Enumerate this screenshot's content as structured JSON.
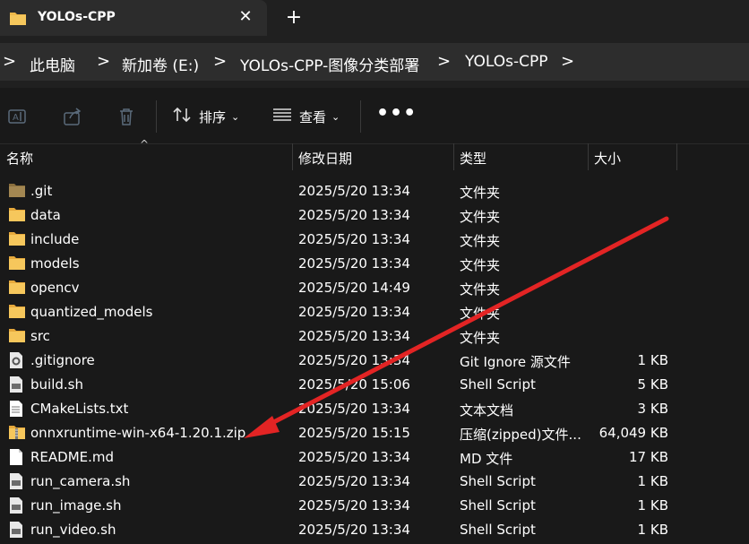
{
  "window": {
    "tab_title": "YOLOs-CPP",
    "close_glyph": "✕",
    "new_tab_glyph": "+"
  },
  "address": {
    "separator": ">",
    "crumbs": [
      "此电脑",
      "新加卷 (E:)",
      "YOLOs-CPP-图像分类部署",
      "YOLOs-CPP"
    ]
  },
  "toolbar": {
    "sort_label": "排序",
    "view_label": "查看",
    "more_label": "•••",
    "icons": [
      "rename-icon",
      "share-icon",
      "delete-icon",
      "sort-icon",
      "view-icon"
    ]
  },
  "columns": {
    "name": "名称",
    "date": "修改日期",
    "type": "类型",
    "size": "大小"
  },
  "files": [
    {
      "name": ".git",
      "date": "2025/5/20 13:34",
      "type": "文件夹",
      "size": "",
      "icon": "folder-dark-icon"
    },
    {
      "name": "data",
      "date": "2025/5/20 13:34",
      "type": "文件夹",
      "size": "",
      "icon": "folder-icon"
    },
    {
      "name": "include",
      "date": "2025/5/20 13:34",
      "type": "文件夹",
      "size": "",
      "icon": "folder-icon"
    },
    {
      "name": "models",
      "date": "2025/5/20 13:34",
      "type": "文件夹",
      "size": "",
      "icon": "folder-icon"
    },
    {
      "name": "opencv",
      "date": "2025/5/20 14:49",
      "type": "文件夹",
      "size": "",
      "icon": "folder-icon"
    },
    {
      "name": "quantized_models",
      "date": "2025/5/20 13:34",
      "type": "文件夹",
      "size": "",
      "icon": "folder-icon"
    },
    {
      "name": "src",
      "date": "2025/5/20 13:34",
      "type": "文件夹",
      "size": "",
      "icon": "folder-icon"
    },
    {
      "name": ".gitignore",
      "date": "2025/5/20 13:34",
      "type": "Git Ignore 源文件",
      "size": "1 KB",
      "icon": "gear-file-icon"
    },
    {
      "name": "build.sh",
      "date": "2025/5/20 15:06",
      "type": "Shell Script",
      "size": "5 KB",
      "icon": "script-file-icon"
    },
    {
      "name": "CMakeLists.txt",
      "date": "2025/5/20 13:34",
      "type": "文本文档",
      "size": "3 KB",
      "icon": "text-file-icon"
    },
    {
      "name": "onnxruntime-win-x64-1.20.1.zip",
      "date": "2025/5/20 15:15",
      "type": "压缩(zipped)文件...",
      "size": "64,049 KB",
      "icon": "zip-folder-icon"
    },
    {
      "name": "README.md",
      "date": "2025/5/20 13:34",
      "type": "MD 文件",
      "size": "17 KB",
      "icon": "document-file-icon"
    },
    {
      "name": "run_camera.sh",
      "date": "2025/5/20 13:34",
      "type": "Shell Script",
      "size": "1 KB",
      "icon": "script-file-icon"
    },
    {
      "name": "run_image.sh",
      "date": "2025/5/20 13:34",
      "type": "Shell Script",
      "size": "1 KB",
      "icon": "script-file-icon"
    },
    {
      "name": "run_video.sh",
      "date": "2025/5/20 13:34",
      "type": "Shell Script",
      "size": "1 KB",
      "icon": "script-file-icon"
    }
  ],
  "annotation": {
    "arrow_color": "#e32424",
    "points_to": "onnxruntime-win-x64-1.20.1.zip"
  },
  "colors": {
    "folder": "#f0b94a",
    "background": "#191919"
  }
}
